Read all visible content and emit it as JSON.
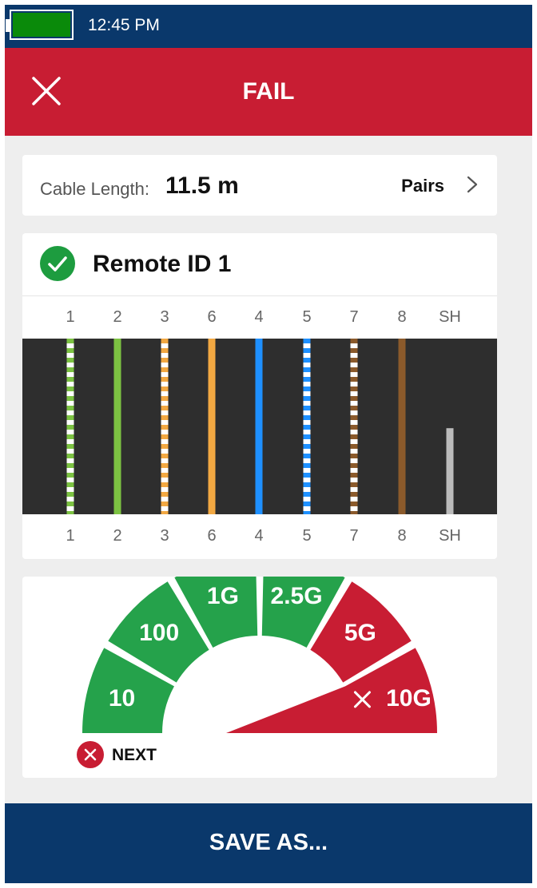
{
  "status_bar": {
    "time": "12:45 PM",
    "battery_color": "#0a8a0a"
  },
  "header": {
    "title": "FAIL",
    "close_icon": "close-icon",
    "color": "#c81d33"
  },
  "cable": {
    "length_label": "Cable Length:",
    "length_value": "11.5 m",
    "pairs_label": "Pairs",
    "pairs_icon": "chevron-right-icon"
  },
  "remote": {
    "title": "Remote ID 1",
    "status_icon": "check-circle-icon",
    "status_color": "#1d9c3f",
    "pins_top": [
      "1",
      "2",
      "3",
      "6",
      "4",
      "5",
      "7",
      "8",
      "SH"
    ],
    "pins_bottom": [
      "1",
      "2",
      "3",
      "6",
      "4",
      "5",
      "7",
      "8",
      "SH"
    ],
    "wires": [
      {
        "pin": "1",
        "color": "#7cc242",
        "striped": true,
        "level": 1.0
      },
      {
        "pin": "2",
        "color": "#7cc242",
        "striped": false,
        "level": 1.0
      },
      {
        "pin": "3",
        "color": "#f2a842",
        "striped": true,
        "level": 1.0
      },
      {
        "pin": "6",
        "color": "#f2a842",
        "striped": false,
        "level": 1.0
      },
      {
        "pin": "4",
        "color": "#1e90ff",
        "striped": false,
        "level": 1.0
      },
      {
        "pin": "5",
        "color": "#1e90ff",
        "striped": true,
        "level": 1.0
      },
      {
        "pin": "7",
        "color": "#8b5a2b",
        "striped": true,
        "level": 1.0
      },
      {
        "pin": "8",
        "color": "#8b5a2b",
        "striped": false,
        "level": 1.0
      },
      {
        "pin": "SH",
        "color": "#bbbbbb",
        "striped": false,
        "level": 0.49
      }
    ]
  },
  "speed": {
    "segments": [
      {
        "label": "10",
        "status": "pass"
      },
      {
        "label": "100",
        "status": "pass"
      },
      {
        "label": "1G",
        "status": "pass"
      },
      {
        "label": "2.5G",
        "status": "pass"
      },
      {
        "label": "5G",
        "status": "fail"
      },
      {
        "label": "10G",
        "status": "fail",
        "icon": "x-icon"
      }
    ],
    "pass_color": "#25a24b",
    "fail_color": "#c81d33",
    "next_label": "NEXT",
    "next_icon": "x-circle-icon"
  },
  "footer": {
    "save_label": "SAVE AS..."
  }
}
